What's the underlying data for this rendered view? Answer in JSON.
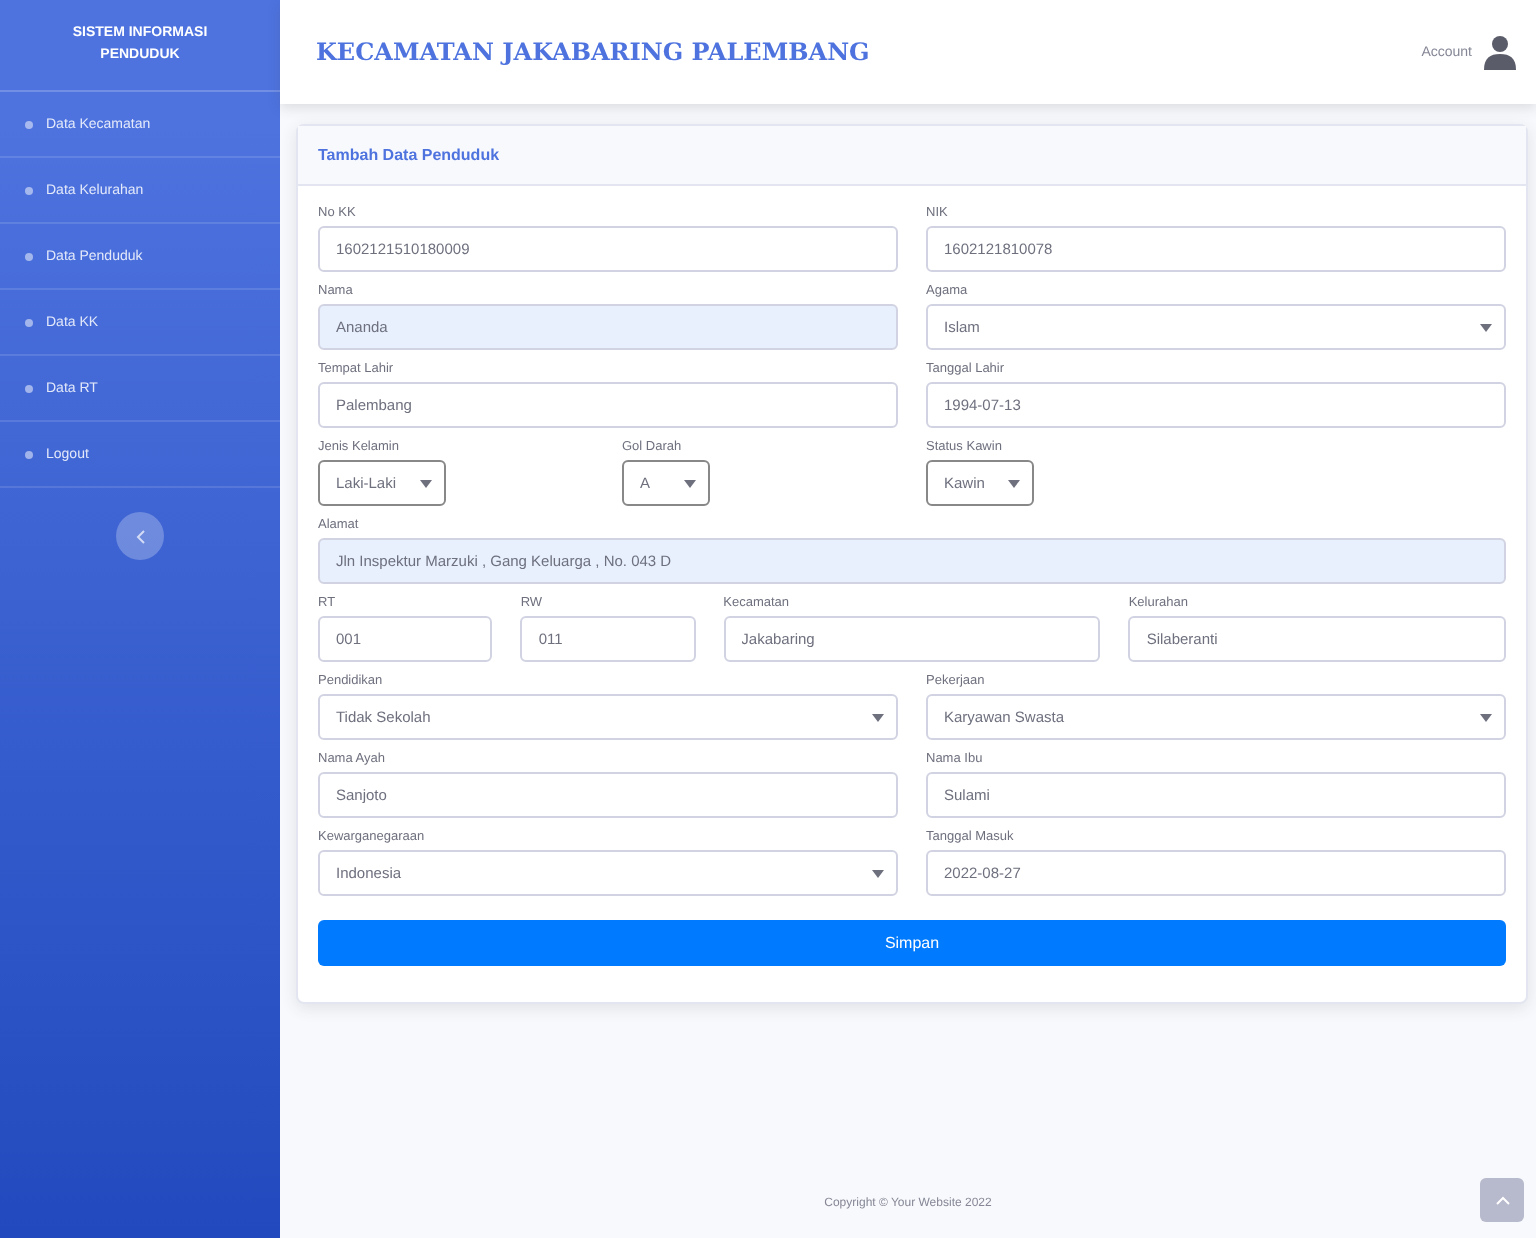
{
  "sidebar": {
    "brand": [
      "SISTEM INFORMASI",
      "PENDUDUK"
    ],
    "items": [
      {
        "label": "Data Kecamatan",
        "selected": false
      },
      {
        "label": "Data Kelurahan",
        "selected": false
      },
      {
        "label": "Data Penduduk",
        "selected": false
      },
      {
        "label": "Data KK",
        "selected": false
      },
      {
        "label": "Data RT",
        "selected": false
      },
      {
        "label": "Logout",
        "selected": false
      }
    ]
  },
  "topbar": {
    "title": "KECAMATAN JAKABARING PALEMBANG",
    "user": "Account"
  },
  "card": {
    "title": "Tambah Data Penduduk",
    "rows": [
      [
        {
          "label": "No KK",
          "value": "1602121510180009",
          "kind": "input",
          "autofill": false
        },
        {
          "label": "NIK",
          "value": "1602121810078",
          "kind": "input",
          "autofill": false
        }
      ],
      [
        {
          "label": "Nama",
          "value": "Ananda",
          "kind": "input",
          "autofill": true
        },
        {
          "label": "Agama",
          "value": "Islam",
          "kind": "select",
          "autofill": false
        }
      ],
      [
        {
          "label": "Tempat Lahir",
          "value": "Palembang",
          "kind": "input",
          "autofill": false
        },
        {
          "label": "Tanggal Lahir",
          "value": "1994-07-13",
          "kind": "input",
          "autofill": false
        }
      ],
      [
        {
          "kind": "group",
          "fields": [
            {
              "label": "Jenis Kelamin",
              "value": "Laki-Laki",
              "kind": "small-select",
              "autofill": false
            },
            {
              "label": "Gol Darah",
              "value": "A",
              "kind": "small-select",
              "autofill": false
            }
          ]
        },
        {
          "label": "Status Kawin",
          "value": "Kawin",
          "kind": "small-select",
          "autofill": false
        }
      ],
      [
        {
          "label": "Alamat",
          "value": "Jln Inspektur Marzuki , Gang Keluarga , No. 043 D",
          "kind": "input",
          "autofill": true
        }
      ],
      [
        {
          "label": "RT",
          "value": "001",
          "kind": "input",
          "autofill": false
        },
        {
          "label": "RW",
          "value": "011",
          "kind": "input",
          "autofill": false
        },
        {
          "label": "Kecamatan",
          "value": "Jakabaring",
          "kind": "input",
          "autofill": false
        },
        {
          "label": "Kelurahan",
          "value": "Silaberanti",
          "kind": "input",
          "autofill": false
        }
      ],
      [
        {
          "label": "Pendidikan",
          "value": "Tidak Sekolah",
          "kind": "select",
          "autofill": false
        },
        {
          "label": "Pekerjaan",
          "value": "Karyawan Swasta",
          "kind": "select",
          "autofill": false
        }
      ],
      [
        {
          "label": "Nama Ayah",
          "value": "Sanjoto",
          "kind": "input",
          "autofill": false
        },
        {
          "label": "Nama Ibu",
          "value": "Sulami",
          "kind": "input",
          "autofill": false
        }
      ],
      [
        {
          "label": "Kewarganegaraan",
          "value": "Indonesia",
          "kind": "select",
          "autofill": false
        },
        {
          "label": "Tanggal Masuk",
          "value": "2022-08-27",
          "kind": "input",
          "autofill": false
        }
      ]
    ],
    "submit": "Simpan"
  },
  "footer": "Copyright © Your Website 2022"
}
